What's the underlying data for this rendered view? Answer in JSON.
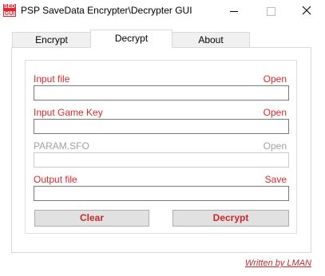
{
  "window": {
    "title": "PSP SaveData Encrypter\\Decrypter GUI",
    "icon_top": "SED",
    "icon_bottom": "GUI"
  },
  "tabs": [
    {
      "label": "Encrypt",
      "active": false
    },
    {
      "label": "Decrypt",
      "active": true
    },
    {
      "label": "About",
      "active": false
    }
  ],
  "form": {
    "input_file": {
      "label": "Input file",
      "action": "Open",
      "value": "",
      "enabled": true
    },
    "game_key": {
      "label": "Input Game Key",
      "action": "Open",
      "value": "",
      "enabled": true
    },
    "param_sfo": {
      "label": "PARAM.SFO",
      "action": "Open",
      "value": "",
      "enabled": false
    },
    "output_file": {
      "label": "Output file",
      "action": "Save",
      "value": "",
      "enabled": true
    }
  },
  "buttons": {
    "clear": "Clear",
    "decrypt": "Decrypt"
  },
  "credit": "Written by LMAN",
  "colors": {
    "accent": "#e0262b",
    "disabled": "#a0a0a0"
  }
}
